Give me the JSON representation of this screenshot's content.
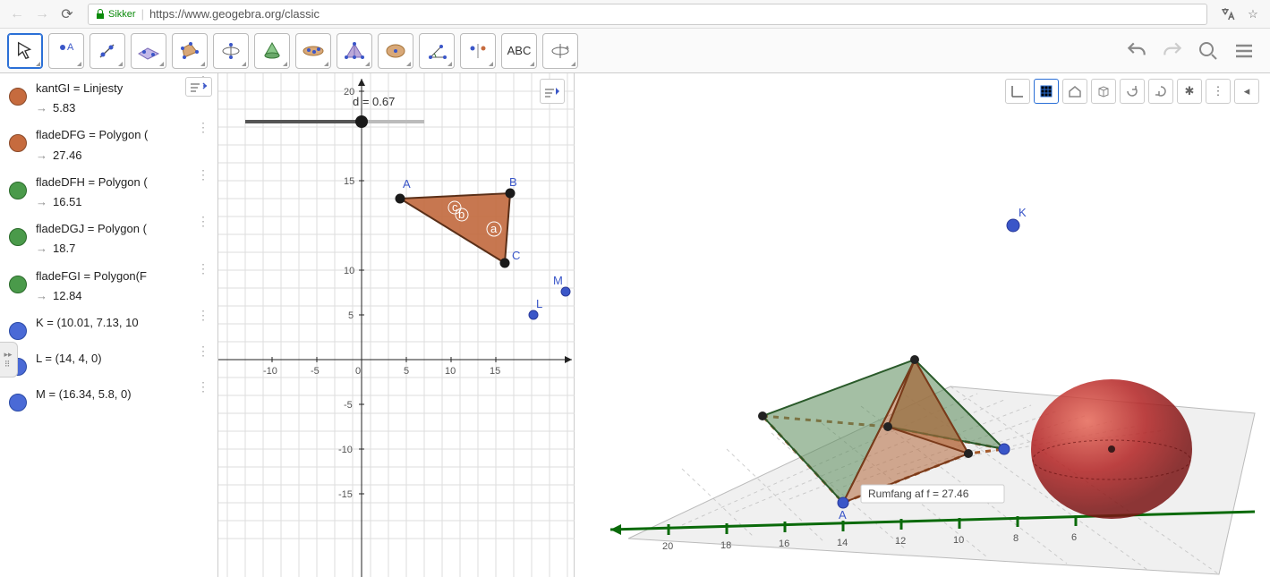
{
  "browser": {
    "secure_label": "Sikker",
    "url": "https://www.geogebra.org/classic"
  },
  "toolbar": {
    "text_tool_label": "ABC"
  },
  "algebra": {
    "items": [
      {
        "color": "orange",
        "name": "kantGI = Linjesty",
        "value": "5.83"
      },
      {
        "color": "orange",
        "name": "fladeDFG = Polygon (",
        "value": "27.46"
      },
      {
        "color": "green",
        "name": "fladeDFH = Polygon (",
        "value": "16.51"
      },
      {
        "color": "green",
        "name": "fladeDGJ = Polygon (",
        "value": "18.7"
      },
      {
        "color": "green",
        "name": "fladeFGI = Polygon(F",
        "value": "12.84"
      },
      {
        "color": "blue",
        "name": "K = (10.01, 7.13, 10",
        "value": ""
      },
      {
        "color": "blue",
        "name": "L = (14, 4, 0)",
        "value": ""
      },
      {
        "color": "blue",
        "name": "M = (16.34, 5.8, 0)",
        "value": ""
      }
    ]
  },
  "view2d": {
    "slider_label": "d = 0.67",
    "x_ticks": [
      "-10",
      "-5",
      "0",
      "5",
      "10",
      "15"
    ],
    "y_ticks": [
      "20",
      "15",
      "10",
      "5",
      "-5",
      "-10",
      "-15"
    ],
    "points": {
      "A": "A",
      "B": "B",
      "C": "C",
      "L": "L",
      "M": "M",
      "a": "a",
      "b": "b",
      "c": "c"
    }
  },
  "view3d": {
    "tooltip": "Rumfang af f = 27.46",
    "K_label": "K",
    "A_label": "A",
    "axis_ticks": [
      "20",
      "18",
      "16",
      "14",
      "12",
      "10",
      "8",
      "6"
    ]
  },
  "colors": {
    "orange": "#c1683d",
    "green": "#5a8a5a",
    "blue": "#3a56c8",
    "red": "#b22222",
    "axis_green": "#0a6a0a"
  }
}
